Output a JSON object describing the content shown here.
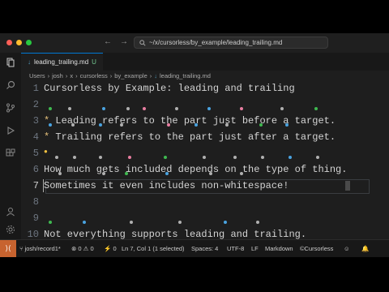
{
  "command_center": {
    "text": "~/x/cursorless/by_example/leading_trailing.md"
  },
  "tab": {
    "label": "leading_trailing.md",
    "status": "U"
  },
  "breadcrumb": [
    "Users",
    "josh",
    "x",
    "cursorless",
    "by_example",
    "leading_trailing.md"
  ],
  "editor": {
    "lines": [
      {
        "n": "1",
        "text": "Cursorless by Example: leading and trailing"
      },
      {
        "n": "2",
        "text": ""
      },
      {
        "n": "3",
        "star": "*",
        "text": " Leading refers to the part just before a target."
      },
      {
        "n": "4",
        "star": "*",
        "text": " Trailing refers to the part just after a target."
      },
      {
        "n": "5",
        "text": ""
      },
      {
        "n": "6",
        "text": "How much gets included depends on the type of thing."
      },
      {
        "n": "7",
        "text": "Sometimes it even includes non-whitespace!"
      },
      {
        "n": "8",
        "text": ""
      },
      {
        "n": "9",
        "text": ""
      },
      {
        "n": "10",
        "text": "Not everything supports leading and trailing."
      }
    ]
  },
  "statusbar": {
    "branch": "josh/record1*",
    "errors": "0",
    "warnings": "0",
    "ports": "0",
    "position": "Ln 7, Col 1 (1 selected)",
    "spaces": "Spaces: 4",
    "encoding": "UTF-8",
    "eol": "LF",
    "language": "Markdown",
    "extension": "Cursorless"
  },
  "colors": {
    "accent": "#0078d4",
    "remote": "#c7632f",
    "hat_blue": "#4aa3e0",
    "hat_green": "#3fb950",
    "hat_pink": "#e87ea1",
    "hat_gray": "#b0b0b0",
    "hat_red": "#e5534b"
  }
}
